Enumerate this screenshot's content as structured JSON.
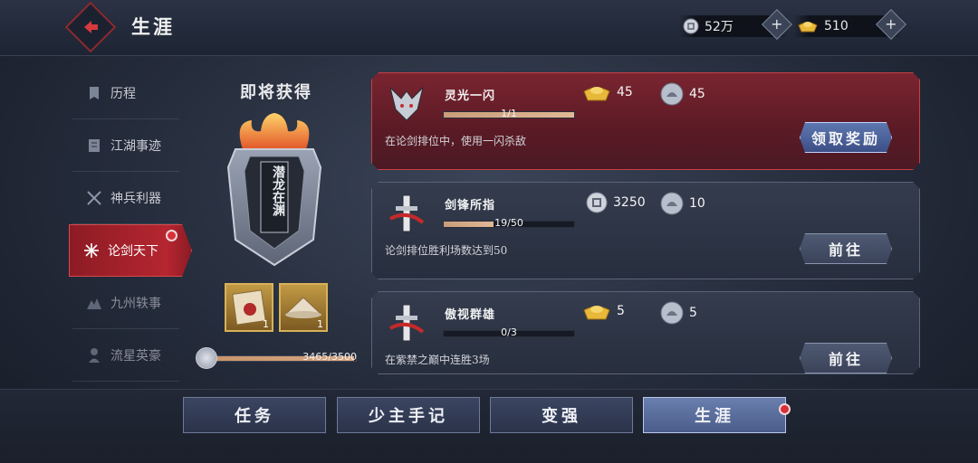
{
  "header": {
    "title": "生涯",
    "silver_amount": "52万",
    "gold_amount": "510"
  },
  "sidebar": {
    "items": [
      {
        "label": "历程",
        "icon": "scroll-icon"
      },
      {
        "label": "江湖事迹",
        "icon": "book-icon"
      },
      {
        "label": "神兵利器",
        "icon": "crossed-swords-icon"
      },
      {
        "label": "论剑天下",
        "icon": "spark-icon",
        "active": true
      },
      {
        "label": "九州轶事",
        "icon": "mountain-icon"
      },
      {
        "label": "流星英豪",
        "icon": "hero-icon"
      }
    ]
  },
  "upcoming": {
    "title": "即将获得",
    "badge_text": "潜龙在渊",
    "item1_count": "1",
    "item2_count": "1",
    "progress_text": "3465/3500",
    "progress_fraction": 0.99
  },
  "tasks": [
    {
      "name": "灵光一闪",
      "progress_text": "1/1",
      "progress_fraction": 1.0,
      "description": "在论剑排位中，使用一闪杀敌",
      "reward1_type": "gold-ingot-icon",
      "reward1_value": "45",
      "reward2_type": "lotus-token-icon",
      "reward2_value": "45",
      "button_label": "领取奖励"
    },
    {
      "name": "剑锋所指",
      "progress_text": "19/50",
      "progress_fraction": 0.38,
      "description": "论剑排位胜利场数达到50",
      "reward1_type": "silver-coin-icon",
      "reward1_value": "3250",
      "reward2_type": "lotus-token-icon",
      "reward2_value": "10",
      "button_label": "前往"
    },
    {
      "name": "傲视群雄",
      "progress_text": "0/3",
      "progress_fraction": 0.0,
      "description": "在紫禁之巅中连胜3场",
      "reward1_type": "gold-ingot-icon",
      "reward1_value": "5",
      "reward2_type": "lotus-token-icon",
      "reward2_value": "5",
      "button_label": "前往"
    }
  ],
  "bottom_tabs": [
    {
      "label": "任务"
    },
    {
      "label": "少主手记"
    },
    {
      "label": "变强"
    },
    {
      "label": "生涯",
      "active": true
    }
  ]
}
